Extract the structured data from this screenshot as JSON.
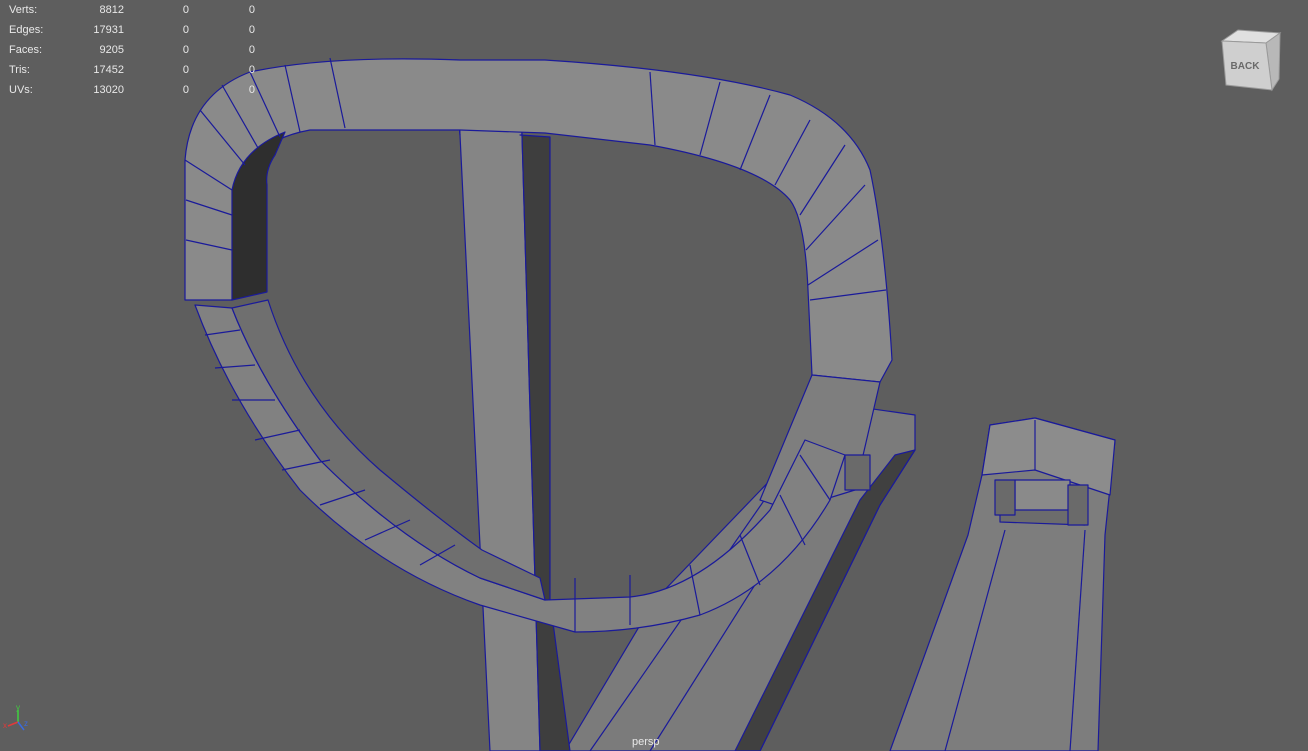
{
  "hud_stats": [
    {
      "label": "Verts:",
      "total": "8812",
      "selected": "0",
      "selected_component": "0"
    },
    {
      "label": "Edges:",
      "total": "17931",
      "selected": "0",
      "selected_component": "0"
    },
    {
      "label": "Faces:",
      "total": "9205",
      "selected": "0",
      "selected_component": "0"
    },
    {
      "label": "Tris:",
      "total": "17452",
      "selected": "0",
      "selected_component": "0"
    },
    {
      "label": "UVs:",
      "total": "13020",
      "selected": "0",
      "selected_component": "0"
    }
  ],
  "camera": {
    "name": "persp"
  },
  "view_cube": {
    "face_label": "BACK"
  },
  "axis_gizmo": {
    "x": "x",
    "y": "y",
    "z": "z"
  },
  "colors": {
    "background": "#5e5e5e",
    "wireframe": "#1a1a9a",
    "face_light": "#8a8a8a",
    "face_mid": "#7a7a7a",
    "face_dark": "#3c3c3c",
    "hud_text": "#e8e8e8"
  }
}
